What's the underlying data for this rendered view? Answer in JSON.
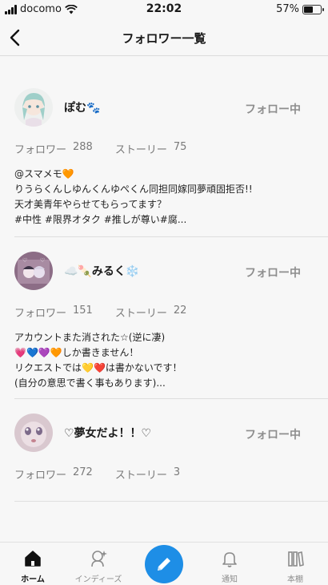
{
  "status_bar": {
    "carrier": "docomo",
    "time": "22:02",
    "battery": "57%",
    "battery_level": 0.57
  },
  "header": {
    "title": "フォロワー一覧",
    "back_icon": "chevron-left-icon"
  },
  "users": [
    {
      "name": "ぽむ🐾",
      "follow_label": "フォロー中",
      "followers_label": "フォロワー",
      "followers": "288",
      "stories_label": "ストーリー",
      "stories": "75",
      "bio": "@スマメモ🧡\nりうらくんしゆんくんゆぺくん同担同嫁同夢頑固拒否!!\n天才美青年やらせてもらってます？\n#中性 #限界オタク #推しが尊い#腐..."
    },
    {
      "name": "☁️🍡みるく❄️",
      "follow_label": "フォロー中",
      "followers_label": "フォロワー",
      "followers": "151",
      "stories_label": "ストーリー",
      "stories": "22",
      "bio": "アカウントまた消された☆(逆に凄)\n💗💙💜🧡しか書きません！\nリクエストでは💛❤️は書かないです！\n(自分の意思で書く事もあります)..."
    },
    {
      "name": "♡夢女だよ！！♡",
      "follow_label": "フォロー中",
      "followers_label": "フォロワー",
      "followers": "272",
      "stories_label": "ストーリー",
      "stories": "3",
      "bio": ""
    }
  ],
  "tab_bar": {
    "tabs": [
      {
        "label": "ホーム",
        "icon": "home-icon",
        "active": true
      },
      {
        "label": "インディーズ",
        "icon": "indies-icon",
        "active": false
      },
      {
        "label": "",
        "icon": "pencil-icon",
        "active": false
      },
      {
        "label": "通知",
        "icon": "bell-icon",
        "active": false
      },
      {
        "label": "本棚",
        "icon": "bookshelf-icon",
        "active": false
      }
    ]
  },
  "colors": {
    "accent": "#1e8ee6",
    "follow_text": "#8e8e8e",
    "background": "#f7f7f7"
  }
}
